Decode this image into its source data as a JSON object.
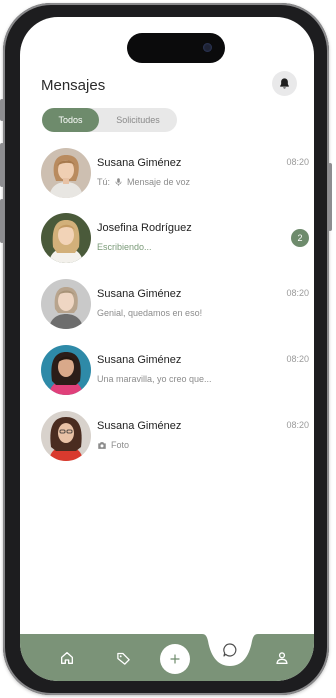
{
  "header": {
    "title": "Mensajes",
    "bell_icon": "bell-icon"
  },
  "tabs": [
    {
      "label": "Todos",
      "active": true
    },
    {
      "label": "Solicitudes",
      "active": false
    }
  ],
  "chats": [
    {
      "name": "Susana Giménez",
      "prefix": "Tú:",
      "preview": "Mensaje de voz",
      "preview_icon": "mic-icon",
      "time": "08:20"
    },
    {
      "name": "Josefina Rodríguez",
      "preview": "Escribiendo...",
      "status": "typing",
      "unread": "2"
    },
    {
      "name": "Susana Giménez",
      "preview": "Genial, quedamos en eso!",
      "time": "08:20"
    },
    {
      "name": "Susana Giménez",
      "preview": "Una maravilla, yo creo que...",
      "time": "08:20"
    },
    {
      "name": "Susana Giménez",
      "preview": "Foto",
      "preview_icon": "camera-icon",
      "time": "08:20"
    }
  ],
  "bottom_nav": {
    "items": [
      {
        "icon": "home-icon"
      },
      {
        "icon": "tag-icon"
      },
      {
        "icon": "plus-icon"
      },
      {
        "icon": "chat-bubble-icon",
        "active": true
      },
      {
        "icon": "profile-icon"
      }
    ]
  },
  "colors": {
    "accent": "#6e8b6c",
    "nav_bg": "#7b9378",
    "background": "#ffffff"
  }
}
